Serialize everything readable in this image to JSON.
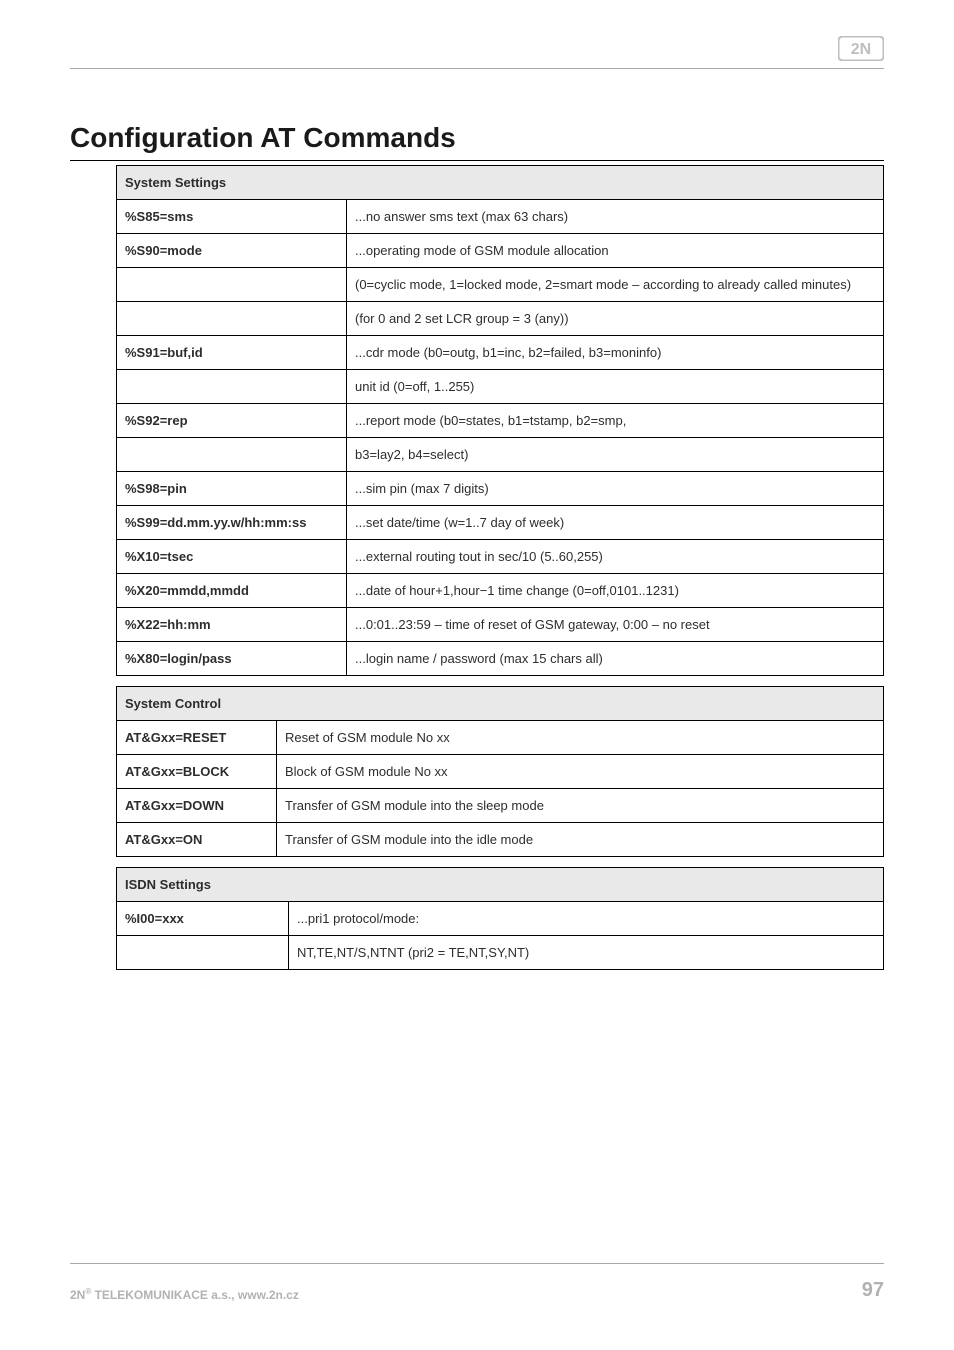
{
  "logo": {
    "name": "2N"
  },
  "heading": "Configuration AT Commands",
  "system_settings": {
    "title": "System Settings",
    "rows": [
      {
        "k": "%S85=sms",
        "v": "...no answer sms text (max 63 chars)"
      },
      {
        "k": "%S90=mode",
        "v": "...operating mode of GSM module allocation"
      },
      {
        "k": "",
        "v": "(0=cyclic mode, 1=locked mode, 2=smart mode – according to already called minutes)"
      },
      {
        "k": "",
        "v": "(for 0 and 2 set LCR group = 3 (any))"
      },
      {
        "k": "%S91=buf,id",
        "v": "...cdr mode (b0=outg, b1=inc, b2=failed, b3=moninfo)"
      },
      {
        "k": "",
        "v": "unit id (0=off, 1..255)"
      },
      {
        "k": "%S92=rep",
        "v": "...report mode (b0=states, b1=tstamp, b2=smp,"
      },
      {
        "k": "",
        "v": "b3=lay2, b4=select)"
      },
      {
        "k": "%S98=pin",
        "v": "...sim pin (max 7 digits)"
      },
      {
        "k": "%S99=dd.mm.yy.w/hh:mm:ss",
        "v": "...set date/time (w=1..7 day of week)"
      },
      {
        "k": "%X10=tsec",
        "v": "...external routing tout in sec/10 (5..60,255)"
      },
      {
        "k": "%X20=mmdd,mmdd",
        "v": "...date of hour+1,hour−1 time change (0=off,0101..1231)"
      },
      {
        "k": "%X22=hh:mm",
        "v": "...0:01..23:59 – time of reset of GSM gateway, 0:00 – no reset"
      },
      {
        "k": "%X80=login/pass",
        "v": "...login name / password (max 15 chars all)"
      }
    ]
  },
  "system_control": {
    "title": "System Control",
    "rows": [
      {
        "k": "AT&Gxx=RESET",
        "v": "Reset of GSM module No xx"
      },
      {
        "k": "AT&Gxx=BLOCK",
        "v": "Block of GSM module No xx"
      },
      {
        "k": "AT&Gxx=DOWN",
        "v": "Transfer of GSM module into the sleep mode"
      },
      {
        "k": "AT&Gxx=ON",
        "v": "Transfer of GSM module into the idle mode"
      }
    ]
  },
  "isdn_settings": {
    "title": "ISDN Settings",
    "rows": [
      {
        "k": "%I00=xxx",
        "v": "...pri1 protocol/mode:"
      },
      {
        "k": "",
        "v": "NT,TE,NT/S,NTNT (pri2 = TE,NT,SY,NT)"
      }
    ]
  },
  "footer": {
    "company_prefix": "2N",
    "company_suffix": " TELEKOMUNIKACE a.s., www.2n.cz",
    "page_number": "97"
  }
}
